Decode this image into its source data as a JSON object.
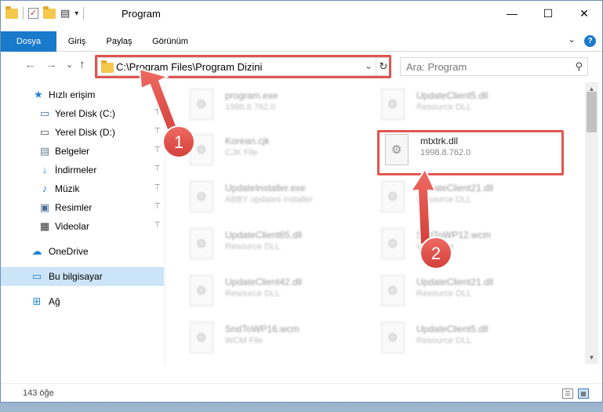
{
  "window": {
    "title": "Program",
    "minimize": "—",
    "maximize": "☐",
    "close": "✕"
  },
  "ribbon": {
    "tabs": [
      "Dosya",
      "Giriş",
      "Paylaş",
      "Görünüm"
    ],
    "help": "?"
  },
  "address": {
    "path": "C:\\Program Files\\Program Dizini",
    "dropdown": "⌄",
    "refresh": "↻"
  },
  "search": {
    "placeholder": "Ara: Program"
  },
  "nav": {
    "back": "←",
    "forward": "→",
    "recent": "⌄",
    "up": "↑"
  },
  "sidebar": {
    "items": [
      {
        "label": "Hızlı erişim",
        "icon": "star-icon",
        "glyph": "★",
        "color": "#1e82d7"
      },
      {
        "label": "Yerel Disk (C:)",
        "icon": "drive-icon",
        "glyph": "▭",
        "color": "#3d6fa8"
      },
      {
        "label": "Yerel Disk (D:)",
        "icon": "drive-icon",
        "glyph": "▭",
        "color": "#555"
      },
      {
        "label": "Belgeler",
        "icon": "documents-icon",
        "glyph": "▤",
        "color": "#6a7f96"
      },
      {
        "label": "İndirmeler",
        "icon": "download-icon",
        "glyph": "↓",
        "color": "#1e82d7"
      },
      {
        "label": "Müzik",
        "icon": "music-icon",
        "glyph": "♪",
        "color": "#1e82d7"
      },
      {
        "label": "Resimler",
        "icon": "pictures-icon",
        "glyph": "▣",
        "color": "#4a6f94"
      },
      {
        "label": "Videolar",
        "icon": "videos-icon",
        "glyph": "▦",
        "color": "#333"
      },
      {
        "label": "OneDrive",
        "icon": "cloud-icon",
        "glyph": "☁",
        "color": "#1e82d7"
      },
      {
        "label": "Bu bilgisayar",
        "icon": "computer-icon",
        "glyph": "▭",
        "color": "#1e82d7"
      },
      {
        "label": "Ağ",
        "icon": "network-icon",
        "glyph": "⊞",
        "color": "#1e82d7"
      }
    ],
    "pin_glyph": "📌"
  },
  "files": [
    {
      "name": "program.exe",
      "sub": "1998.8.762.0"
    },
    {
      "name": "UpdateClient5.dll",
      "sub": "Resource DLL"
    },
    {
      "name": "Korean.cjk",
      "sub": "CJK File"
    },
    {
      "name": "mtxtrk.dll",
      "sub": "1998.8.762.0"
    },
    {
      "name": "UpdateInstaller.exe",
      "sub": "ABBY updates installer"
    },
    {
      "name": "UpdateClient21.dll",
      "sub": "Resource DLL"
    },
    {
      "name": "UpdateClient65.dll",
      "sub": "Resource DLL"
    },
    {
      "name": "SndToWP12.wcm",
      "sub": "WCM File"
    },
    {
      "name": "UpdateClient42.dll",
      "sub": "Resource DLL"
    },
    {
      "name": "UpdateClient21.dll",
      "sub": "Resource DLL"
    },
    {
      "name": "SndToWP16.wcm",
      "sub": "WCM File"
    },
    {
      "name": "UpdateClient5.dll",
      "sub": "Resource DLL"
    }
  ],
  "status": {
    "count": "143 öğe"
  },
  "annotations": {
    "step1": "1",
    "step2": "2",
    "color": "#e15550"
  }
}
